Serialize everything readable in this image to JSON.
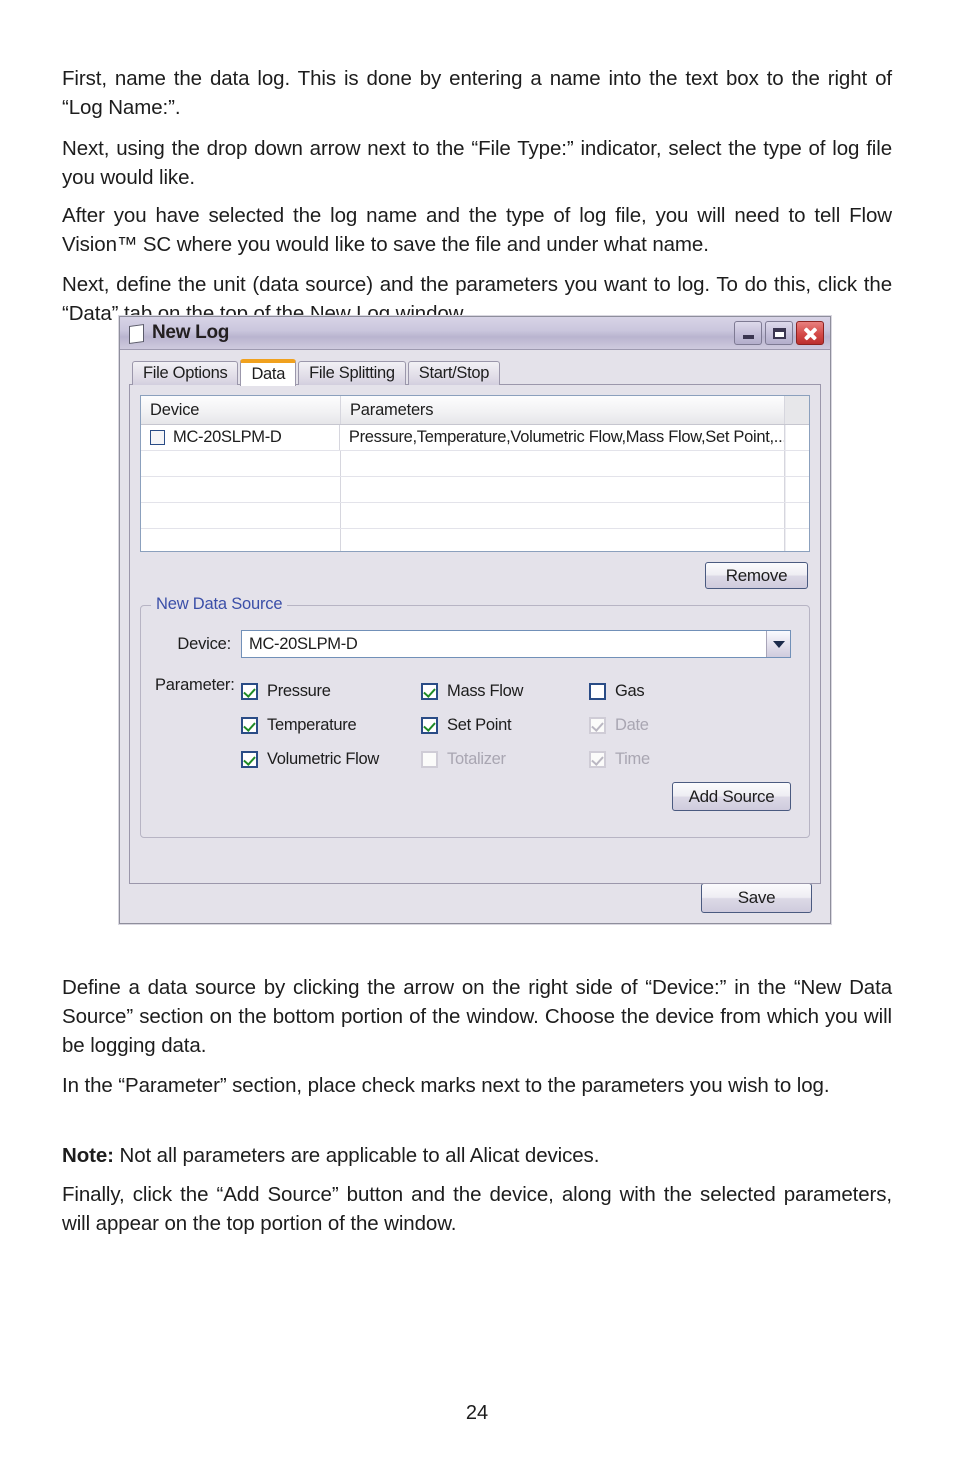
{
  "document": {
    "page_number": "24",
    "paragraphs": {
      "p1": "First, name the data log. This is done by entering a name into the text box to the right of “Log Name:”.",
      "p2": "Next, using the drop down arrow next to the “File Type:” indicator, select the type of log file you would like.",
      "p3": "After you have selected the log name and the type of log file, you will need to tell Flow Vision™ SC where you would like to save the file and under what name.",
      "p4": "Next, define the unit (data source) and the parameters you want to log. To do this, click the “Data” tab on the top of the New Log window.",
      "p5": "Define a data source by clicking the arrow on the right side of “Device:” in the “New Data Source” section on the bottom portion of the window. Choose the device from which you will be logging data.",
      "p6": "In the “Parameter” section, place check marks next to the parameters you wish to log.",
      "p7_label": "Note:",
      "p7_text": " Not all parameters are applicable to all Alicat devices.",
      "p8": "Finally, click the “Add Source” button and the device, along with the selected parameters, will appear on the top portion of the window."
    }
  },
  "dialog": {
    "title": "New Log",
    "title_icon": "document-icon",
    "window_controls": {
      "minimize": "minimize-icon",
      "maximize": "maximize-icon",
      "close": "close-icon"
    },
    "tabs": [
      {
        "label": "File Options",
        "active": false
      },
      {
        "label": "Data",
        "active": true
      },
      {
        "label": "File Splitting",
        "active": false
      },
      {
        "label": "Start/Stop",
        "active": false
      }
    ],
    "grid": {
      "columns": [
        "Device",
        "Parameters"
      ],
      "rows": [
        {
          "checked": false,
          "device": "MC-20SLPM-D",
          "parameters": "Pressure,Temperature,Volumetric Flow,Mass Flow,Set Point,..."
        }
      ],
      "empty_row_count": 4
    },
    "remove_button": "Remove",
    "new_data_source": {
      "legend": "New Data Source",
      "device_label": "Device:",
      "device_value": "MC-20SLPM-D",
      "parameter_label": "Parameter:",
      "parameters": [
        [
          {
            "label": "Pressure",
            "checked": true,
            "disabled": false
          },
          {
            "label": "Temperature",
            "checked": true,
            "disabled": false
          },
          {
            "label": "Volumetric Flow",
            "checked": true,
            "disabled": false
          }
        ],
        [
          {
            "label": "Mass Flow",
            "checked": true,
            "disabled": false
          },
          {
            "label": "Set Point",
            "checked": true,
            "disabled": false
          },
          {
            "label": "Totalizer",
            "checked": false,
            "disabled": true
          }
        ],
        [
          {
            "label": "Gas",
            "checked": false,
            "disabled": false
          },
          {
            "label": "Date",
            "checked": true,
            "disabled": true
          },
          {
            "label": "Time",
            "checked": true,
            "disabled": true
          }
        ]
      ],
      "add_source_button": "Add Source"
    },
    "save_button": "Save",
    "colors": {
      "active_tab_accent": "#f0a11e",
      "group_legend": "#3b4fa8",
      "checkmark": "#1f8b26",
      "close_button": "#d44a48",
      "titlebar": "#cac6dd"
    }
  }
}
